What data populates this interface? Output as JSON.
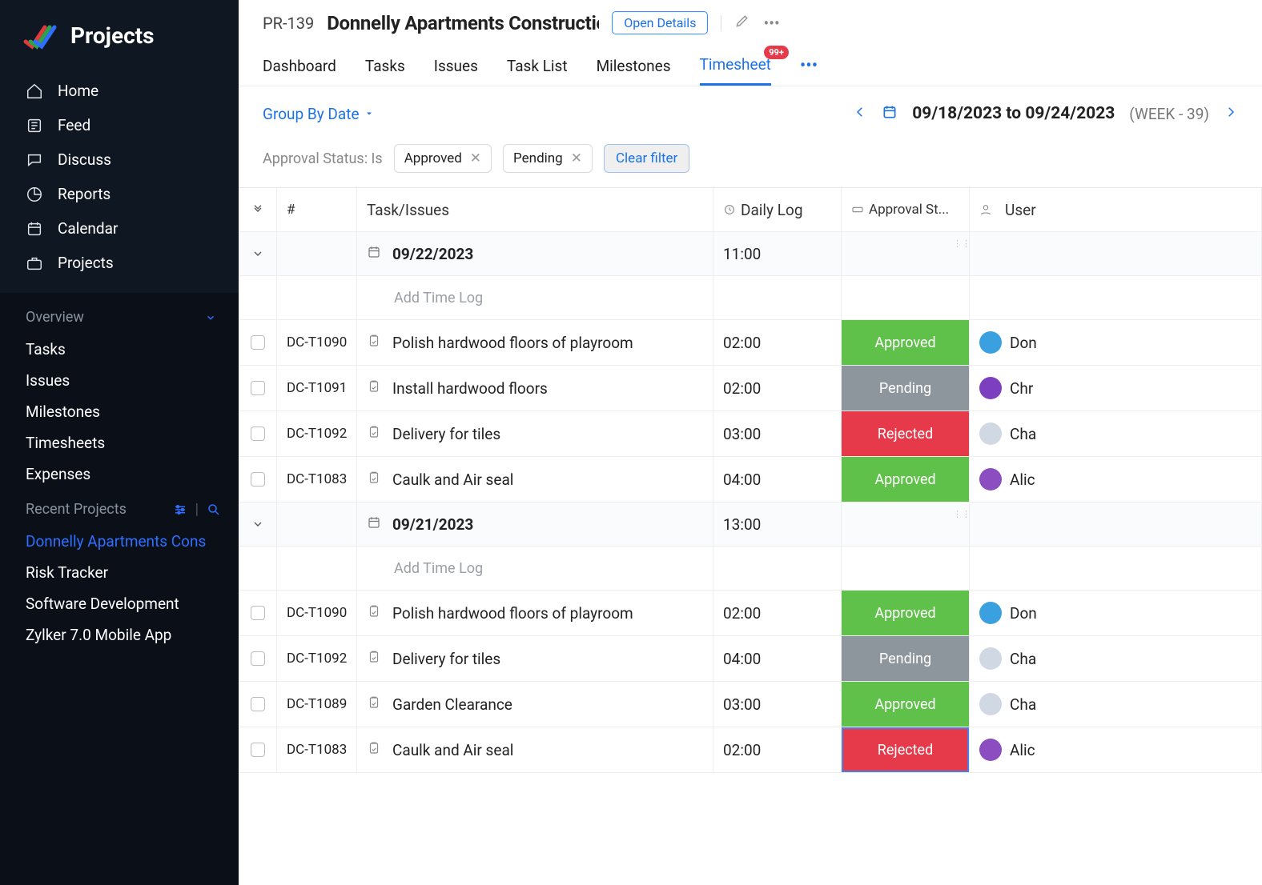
{
  "brand": {
    "title": "Projects"
  },
  "navTop": [
    {
      "label": "Home"
    },
    {
      "label": "Feed"
    },
    {
      "label": "Discuss"
    },
    {
      "label": "Reports"
    },
    {
      "label": "Calendar"
    },
    {
      "label": "Projects"
    }
  ],
  "overview": {
    "title": "Overview",
    "items": [
      {
        "label": "Tasks"
      },
      {
        "label": "Issues"
      },
      {
        "label": "Milestones"
      },
      {
        "label": "Timesheets"
      },
      {
        "label": "Expenses"
      }
    ]
  },
  "recents": {
    "title": "Recent Projects",
    "items": [
      {
        "label": "Donnelly Apartments Cons",
        "active": true
      },
      {
        "label": "Risk Tracker"
      },
      {
        "label": "Software Development"
      },
      {
        "label": "Zylker 7.0 Mobile App"
      }
    ]
  },
  "project": {
    "code": "PR-139",
    "name": "Donnelly Apartments Constructic",
    "openDetails": "Open Details"
  },
  "tabs": [
    {
      "label": "Dashboard"
    },
    {
      "label": "Tasks"
    },
    {
      "label": "Issues"
    },
    {
      "label": "Task List"
    },
    {
      "label": "Milestones"
    },
    {
      "label": "Timesheet",
      "badge": "99+",
      "active": true
    }
  ],
  "toolbar": {
    "groupBy": "Group By Date",
    "range": "09/18/2023 to 09/24/2023",
    "week": "(WEEK - 39)"
  },
  "filter": {
    "label": "Approval Status: Is",
    "chips": [
      {
        "label": "Approved"
      },
      {
        "label": "Pending"
      }
    ],
    "clear": "Clear filter"
  },
  "columns": {
    "hash": "#",
    "task": "Task/Issues",
    "daily": "Daily Log",
    "approval": "Approval St...",
    "user": "User"
  },
  "addTimeLog": "Add Time Log",
  "groups": [
    {
      "date": "09/22/2023",
      "total": "11:00",
      "rows": [
        {
          "id": "DC-T1090",
          "task": "Polish hardwood floors of playroom",
          "log": "02:00",
          "status": "Approved",
          "user": "Don",
          "color": "#3aa0e0"
        },
        {
          "id": "DC-T1091",
          "task": "Install hardwood floors",
          "log": "02:00",
          "status": "Pending",
          "user": "Chr",
          "color": "#7d3fbf"
        },
        {
          "id": "DC-T1092",
          "task": "Delivery for tiles",
          "log": "03:00",
          "status": "Rejected",
          "user": "Cha",
          "color": "#cfd8e3"
        },
        {
          "id": "DC-T1083",
          "task": "Caulk and Air seal",
          "log": "04:00",
          "status": "Approved",
          "user": "Alic",
          "color": "#8b4dbf"
        }
      ]
    },
    {
      "date": "09/21/2023",
      "total": "13:00",
      "rows": [
        {
          "id": "DC-T1090",
          "task": "Polish hardwood floors of playroom",
          "log": "02:00",
          "status": "Approved",
          "user": "Don",
          "color": "#3aa0e0"
        },
        {
          "id": "DC-T1092",
          "task": "Delivery for tiles",
          "log": "04:00",
          "status": "Pending",
          "user": "Cha",
          "color": "#cfd8e3"
        },
        {
          "id": "DC-T1089",
          "task": "Garden Clearance",
          "log": "03:00",
          "status": "Approved",
          "user": "Cha",
          "color": "#cfd8e3"
        },
        {
          "id": "DC-T1083",
          "task": "Caulk and Air seal",
          "log": "02:00",
          "status": "Rejected",
          "user": "Alic",
          "color": "#8b4dbf",
          "focus": true
        }
      ]
    }
  ]
}
